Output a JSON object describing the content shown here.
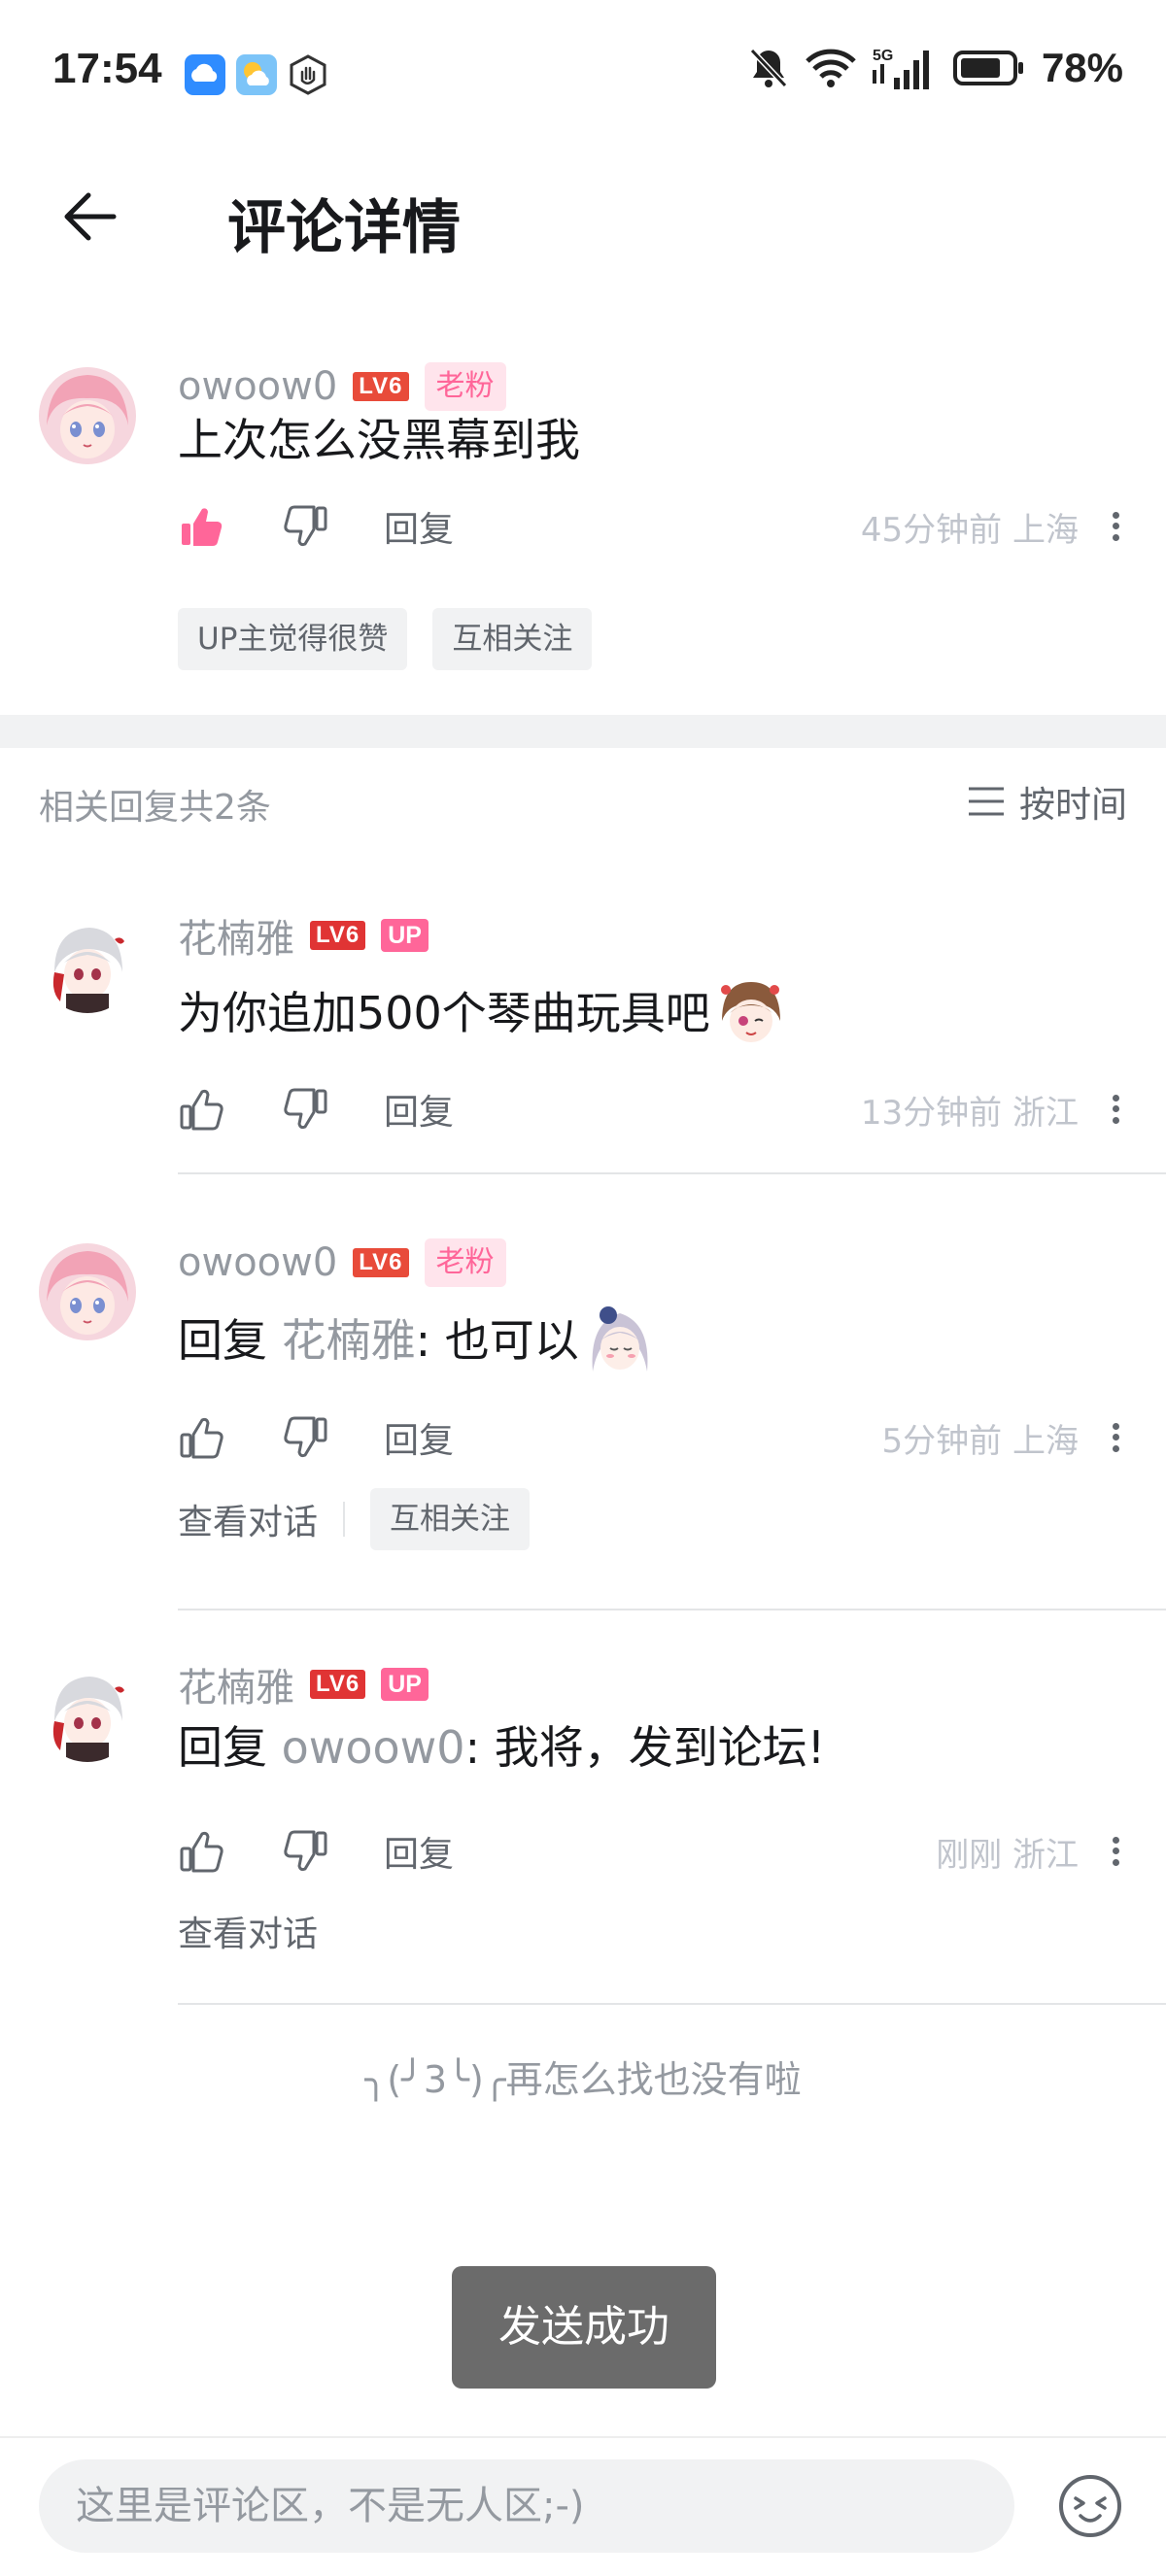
{
  "status_bar": {
    "time": "17:54",
    "battery": "78%",
    "network": "5G",
    "icons": [
      "cloud-app-icon",
      "weather-app-icon",
      "gesture-app-icon",
      "mute-icon",
      "wifi-icon",
      "signal-icon",
      "battery-icon"
    ]
  },
  "header": {
    "title": "评论详情",
    "back_icon": "back-arrow-icon"
  },
  "main_comment": {
    "username": "owoow0",
    "level": "LV6",
    "fan_badge": "老粉",
    "content": "上次怎么没黑幕到我",
    "reply_label": "回复",
    "time": "45分钟前",
    "location": "上海",
    "liked": true,
    "tags": [
      "UP主觉得很赞",
      "互相关注"
    ]
  },
  "replies_header": {
    "count_text": "相关回复共2条",
    "sort_label": "按时间"
  },
  "replies": [
    {
      "username": "花楠雅",
      "level": "LV6",
      "up_badge": "UP",
      "content": "为你追加500个琴曲玩具吧",
      "emote": "anime-girl-wink-emote",
      "reply_label": "回复",
      "time": "13分钟前",
      "location": "浙江"
    },
    {
      "username": "owoow0",
      "level": "LV6",
      "fan_badge": "老粉",
      "reply_prefix": "回复",
      "mention": "花楠雅",
      "content": ": 也可以",
      "emote": "anime-girl-shy-emote",
      "reply_label": "回复",
      "time": "5分钟前",
      "location": "上海",
      "view_conversation": "查看对话",
      "tag": "互相关注"
    },
    {
      "username": "花楠雅",
      "level": "LV6",
      "up_badge": "UP",
      "reply_prefix": "回复",
      "mention": "owoow0",
      "content": ": 我将，发到论坛!",
      "reply_label": "回复",
      "time": "刚刚",
      "location": "浙江",
      "view_conversation": "查看对话"
    }
  ],
  "end_text": "╮(╯3╰)╭再怎么找也没有啦",
  "toast": "发送成功",
  "input": {
    "placeholder": "这里是评论区，不是无人区;-)",
    "value": ""
  },
  "colors": {
    "pink": "#ff6699",
    "gray_text": "#9499a0",
    "level_red": "#e84b3a"
  }
}
